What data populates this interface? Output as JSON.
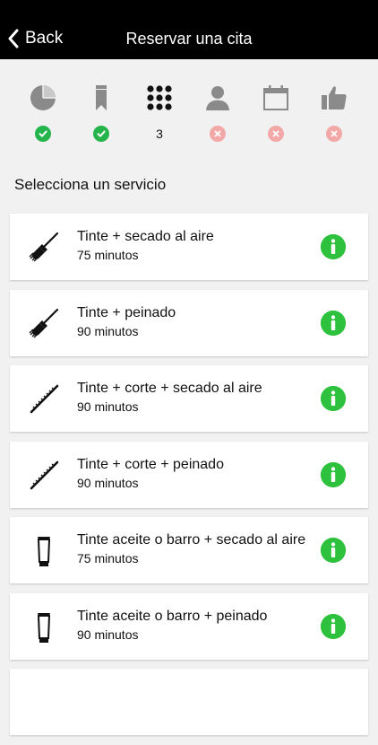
{
  "nav": {
    "back_label": "Back",
    "title": "Reservar una cita"
  },
  "steps": [
    {
      "icon": "pie-chart-icon",
      "status": "done"
    },
    {
      "icon": "bookmark-icon",
      "status": "done"
    },
    {
      "icon": "grid-dots-icon",
      "status": "current",
      "label": "3"
    },
    {
      "icon": "person-icon",
      "status": "pending"
    },
    {
      "icon": "calendar-icon",
      "status": "pending"
    },
    {
      "icon": "thumbs-up-icon",
      "status": "pending"
    }
  ],
  "section_title": "Selecciona un servicio",
  "services": [
    {
      "name": "Tinte + secado al aire",
      "duration": "75 minutos",
      "icon": "brush-icon"
    },
    {
      "name": "Tinte + peinado",
      "duration": "90 minutos",
      "icon": "brush-icon"
    },
    {
      "name": "Tinte + corte + secado al aire",
      "duration": "90 minutos",
      "icon": "comb-icon"
    },
    {
      "name": "Tinte + corte + peinado",
      "duration": "90 minutos",
      "icon": "comb-icon"
    },
    {
      "name": "Tinte aceite o barro + secado al aire",
      "duration": "75 minutos",
      "icon": "tube-icon"
    },
    {
      "name": "Tinte aceite o barro + peinado",
      "duration": "90 minutos",
      "icon": "tube-icon"
    }
  ],
  "colors": {
    "navbar": "#000000",
    "done": "#25b44b",
    "pending": "#f3a8a8",
    "info": "#2ec13d",
    "background": "#f1f1f1"
  }
}
